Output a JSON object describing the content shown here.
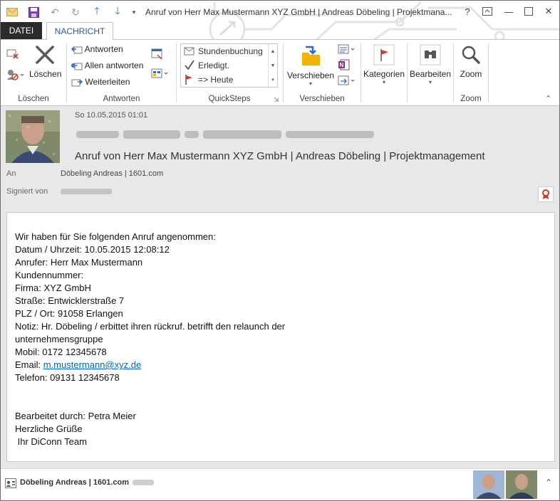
{
  "window": {
    "title": "Anruf von Herr Max Mustermann XYZ GmbH | Andreas Döbeling | Projektmana...",
    "help": "?",
    "minimize": "—",
    "close": "✕"
  },
  "tabs": {
    "datei": "DATEI",
    "nachricht": "NACHRICHT"
  },
  "ribbon": {
    "loeschen": {
      "delete_label": "Löschen",
      "group": "Löschen"
    },
    "antworten": {
      "reply": "Antworten",
      "reply_all": "Allen antworten",
      "forward": "Weiterleiten",
      "group": "Antworten"
    },
    "quicksteps": {
      "items": [
        "Stundenbuchung",
        "Erledigt.",
        "=> Heute"
      ],
      "group": "QuickSteps"
    },
    "verschieben": {
      "move": "Verschieben",
      "group": "Verschieben"
    },
    "kategorien": {
      "label": "Kategorien"
    },
    "bearbeiten": {
      "label": "Bearbeiten"
    },
    "zoom": {
      "label": "Zoom",
      "group": "Zoom"
    }
  },
  "header": {
    "date": "So 10.05.2015 01:01",
    "subject": "Anruf von Herr Max Mustermann XYZ GmbH | Andreas Döbeling | Projektmanagement",
    "to_label": "An",
    "to_value": "Döbeling Andreas | 1601.com",
    "signed_label": "Signiert von"
  },
  "message": {
    "lines": [
      "Wir haben für Sie folgenden Anruf angenommen:",
      "Datum / Uhrzeit: 10.05.2015 12:08:12",
      "Anrufer: Herr Max Mustermann",
      "Kundennummer:",
      "Firma: XYZ GmbH",
      "Straße: Entwicklerstraße 7",
      "PLZ / Ort: 91058 Erlangen",
      "Notiz: Hr. Döbeling / erbittet ihren rückruf. betrifft den relaunch der",
      "unternehmensgruppe",
      "Mobil: 0172 12345678"
    ],
    "email_label": "Email: ",
    "email_link": "m.mustermann@xyz.de",
    "phone": "Telefon: 09131 12345678",
    "blank1": "",
    "blank2": "",
    "closing": [
      "Bearbeitet durch: Petra Meier",
      "Herzliche Grüße",
      " Ihr DiConn Team"
    ]
  },
  "people_pane": {
    "name": "Döbeling Andreas | 1601.com"
  },
  "colors": {
    "accent": "#2b579a",
    "header_bg": "#e8e8e8",
    "link": "#0563c1"
  }
}
